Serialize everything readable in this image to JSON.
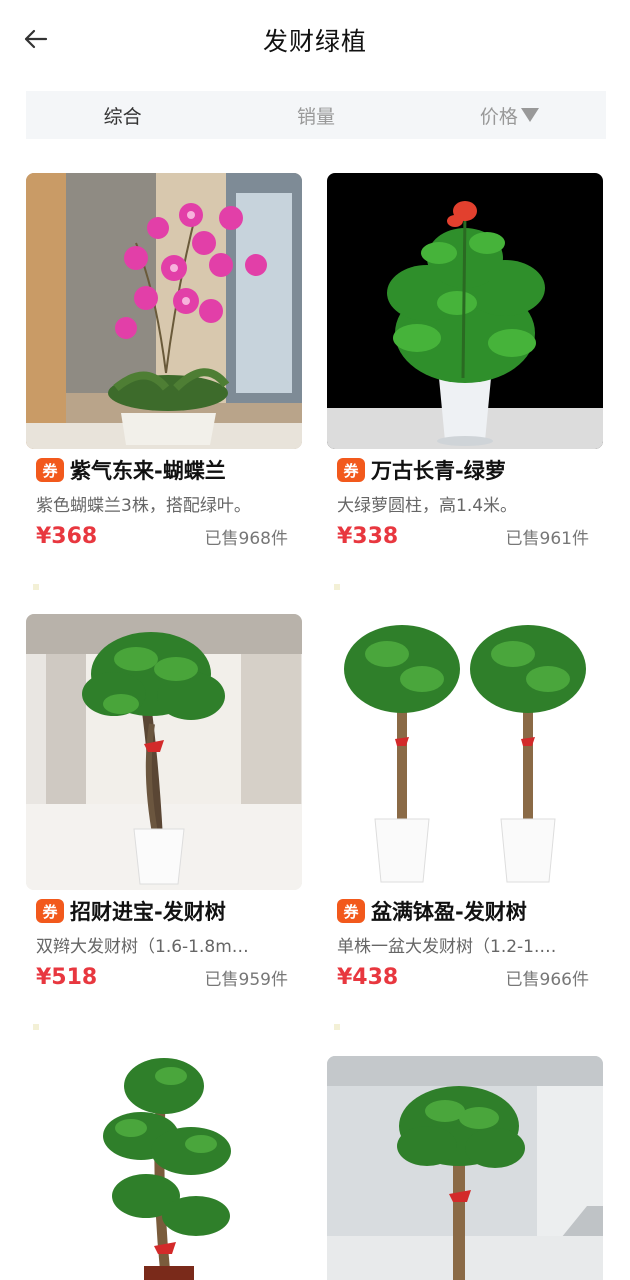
{
  "header": {
    "title": "发财绿植"
  },
  "sort_tabs": {
    "comprehensive": "综合",
    "sales": "销量",
    "price": "价格"
  },
  "coupon_label": "券",
  "products": [
    {
      "name": "紫气东来-蝴蝶兰",
      "desc": "紫色蝴蝶兰3株，搭配绿叶。",
      "price": "¥368",
      "sold": "已售968件"
    },
    {
      "name": "万古长青-绿萝",
      "desc": "大绿萝圆柱，高1.4米。",
      "price": "¥338",
      "sold": "已售961件"
    },
    {
      "name": "招财进宝-发财树",
      "desc": "双辫大发财树（1.6-1.8m…",
      "price": "¥518",
      "sold": "已售959件"
    },
    {
      "name": "盆满钵盈-发财树",
      "desc": "单株一盆大发财树（1.2-1.…",
      "price": "¥438",
      "sold": "已售966件"
    }
  ]
}
